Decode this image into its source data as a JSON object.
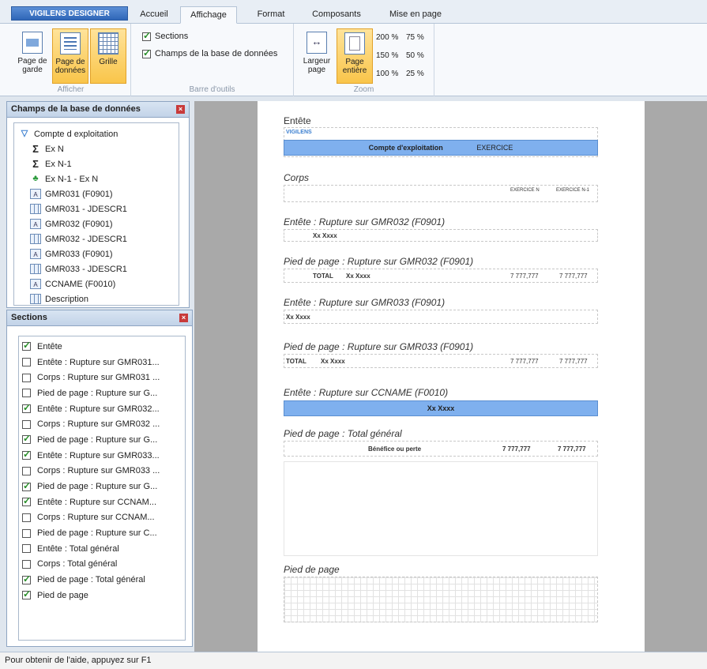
{
  "ribbon": {
    "app_button": "VIGILENS DESIGNER",
    "tabs": [
      "Accueil",
      "Affichage",
      "Format",
      "Composants",
      "Mise en page"
    ],
    "active_tab": "Affichage",
    "afficher": {
      "buttons": [
        "Page de garde",
        "Page de données",
        "Grille"
      ],
      "label": "Afficher"
    },
    "toolbar": {
      "sections_label": "Sections",
      "fields_label": "Champs de la base de données",
      "label": "Barre d'outils"
    },
    "zoom": {
      "width_button": "Largeur page",
      "whole_button": "Page entière",
      "levels": [
        "200 %",
        "75 %",
        "150 %",
        "50 %",
        "100 %",
        "25 %"
      ],
      "label": "Zoom"
    }
  },
  "fields_panel": {
    "title": "Champs de la base de données",
    "items": [
      {
        "label": "Compte d exploitation",
        "icon": "funnel-icon"
      },
      {
        "label": "Ex N",
        "icon": "sigma-icon"
      },
      {
        "label": "Ex N-1",
        "icon": "sigma-icon"
      },
      {
        "label": "Ex N-1 - Ex N",
        "icon": "plant-icon"
      },
      {
        "label": "GMR031 (F0901)",
        "icon": "field-icon"
      },
      {
        "label": "GMR031 - JDESCR1",
        "icon": "table-icon"
      },
      {
        "label": "GMR032 (F0901)",
        "icon": "field-icon"
      },
      {
        "label": "GMR032 - JDESCR1",
        "icon": "table-icon"
      },
      {
        "label": "GMR033 (F0901)",
        "icon": "field-icon"
      },
      {
        "label": "GMR033 - JDESCR1",
        "icon": "table-icon"
      },
      {
        "label": "CCNAME (F0010)",
        "icon": "field-icon"
      },
      {
        "label": "Description",
        "icon": "table-icon"
      }
    ]
  },
  "sections_panel": {
    "title": "Sections",
    "items": [
      {
        "label": "Entête",
        "checked": true
      },
      {
        "label": "Entête : Rupture sur GMR031...",
        "checked": false
      },
      {
        "label": "Corps : Rupture sur GMR031 ...",
        "checked": false
      },
      {
        "label": "Pied de page : Rupture sur G...",
        "checked": false
      },
      {
        "label": "Entête : Rupture sur GMR032...",
        "checked": true
      },
      {
        "label": "Corps : Rupture sur GMR032 ...",
        "checked": false
      },
      {
        "label": "Pied de page : Rupture sur G...",
        "checked": true
      },
      {
        "label": "Entête : Rupture sur GMR033...",
        "checked": true
      },
      {
        "label": "Corps : Rupture sur GMR033 ...",
        "checked": false
      },
      {
        "label": "Pied de page : Rupture sur G...",
        "checked": true
      },
      {
        "label": "Entête : Rupture sur CCNAM...",
        "checked": true
      },
      {
        "label": "Corps : Rupture sur CCNAM...",
        "checked": false
      },
      {
        "label": "Pied de page : Rupture sur C...",
        "checked": false
      },
      {
        "label": "Entête : Total général",
        "checked": false
      },
      {
        "label": "Corps : Total général",
        "checked": false
      },
      {
        "label": "Pied de page : Total général",
        "checked": true
      },
      {
        "label": "Pied de page",
        "checked": true
      }
    ]
  },
  "report": {
    "entete_title": "Entête",
    "logo_text": "VIGILENS",
    "header_band": "Compte d'exploitation",
    "header_band_extra": "EXERCICE",
    "corps_title": "Corps",
    "corps_cells": [
      "EXERCICE N",
      "EXERCICE N-1"
    ],
    "rupt032_title": "Entête : Rupture sur GMR032 (F0901)",
    "rupt032_cell": "Xx Xxxx",
    "pied032_title": "Pied de page : Rupture sur GMR032 (F0901)",
    "pied032_cells": [
      "TOTAL",
      "Xx Xxxx",
      "7 777,777",
      "7 777,777"
    ],
    "rupt033_title": "Entête : Rupture sur GMR033 (F0901)",
    "rupt033_cell": "Xx Xxxx",
    "pied033_title": "Pied de page : Rupture sur GMR033 (F0901)",
    "pied033_cells": [
      "TOTAL",
      "Xx Xxxx",
      "7 777,777",
      "7 777,777"
    ],
    "ccname_title": "Entête : Rupture sur CCNAME (F0010)",
    "ccname_band": "Xx Xxxx",
    "total_title": "Pied de page : Total général",
    "total_cells": [
      "Bénéfice ou perte",
      "7 777,777",
      "7 777,777"
    ],
    "footer_title": "Pied de page"
  },
  "status_bar": "Pour obtenir de l'aide, appuyez sur F1"
}
